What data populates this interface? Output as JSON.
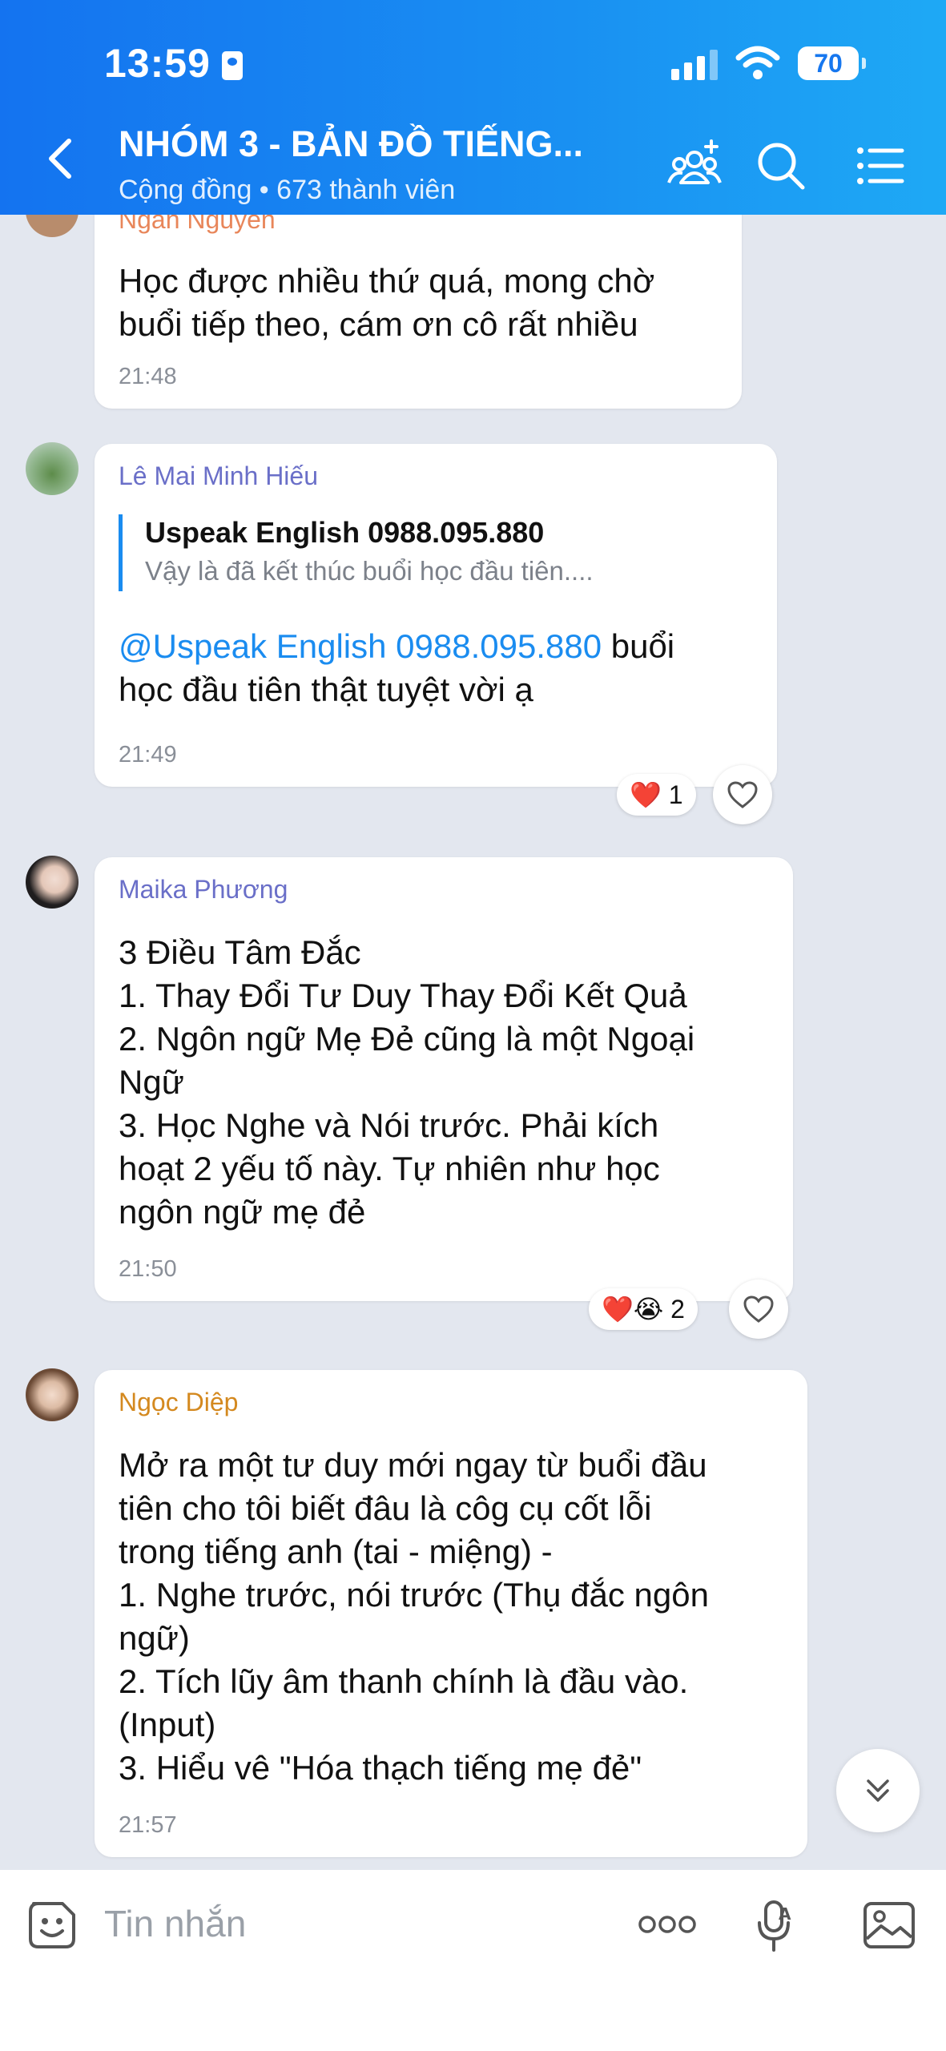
{
  "status_bar": {
    "time": "13:59",
    "battery": "70"
  },
  "header": {
    "title": "NHÓM 3 - BẢN ĐỒ TIẾNG...",
    "subtitle": "Cộng đồng • 673 thành viên"
  },
  "messages": [
    {
      "sender": "Ngan Nguyen",
      "text": "Học được nhiều thứ quá, mong chờ\nbuổi tiếp theo, cám ơn cô rất nhiều",
      "time": "21:48"
    },
    {
      "sender": "Lê Mai Minh Hiếu",
      "quote_author": "Uspeak English 0988.095.880",
      "quote_text": "Vậy là đã kết thúc buổi học đầu tiên....",
      "mention": "@Uspeak English 0988.095.880",
      "text_after_mention": " buổi\nhọc đầu tiên thật tuyệt vời ạ",
      "time": "21:49",
      "reaction_emojis": "❤️",
      "reaction_count": "1"
    },
    {
      "sender": "Maika Phương",
      "text": "3 Điều Tâm Đắc\n1. Thay Đổi Tư Duy Thay Đổi Kết Quả\n2. Ngôn ngữ Mẹ Đẻ cũng là một Ngoại\nNgữ\n3. Học Nghe và Nói trước. Phải kích\nhoạt 2 yếu tố này. Tự nhiên như học\nngôn ngữ mẹ đẻ",
      "time": "21:50",
      "reaction_emojis": "❤️😭",
      "reaction_count": "2"
    },
    {
      "sender": "Ngọc Diệp",
      "text": "Mở ra một tư duy mới ngay từ buổi đầu\ntiên cho tôi biết đâu là côg cụ cốt lỗi\ntrong tiếng anh (tai - miệng) -\n 1. Nghe trước, nói trước (Thụ đắc ngôn\nngữ)\n2. Tích lũy âm thanh chính là đầu vào.\n(Input)\n3. Hiểu vê \"Hóa thạch tiếng mẹ đẻ\"",
      "time": "21:57"
    }
  ],
  "composer": {
    "placeholder": "Tin nhắn"
  },
  "colors": {
    "header_start": "#1473f0",
    "header_end": "#1ea9f5",
    "chat_background": "#e3e7ef",
    "sender_ngan": "#e8865a",
    "sender_hieu": "#6a6fc8",
    "sender_maika": "#6a6fc8",
    "sender_diep": "#d4891f",
    "mention": "#1a8cf0"
  },
  "icons": {
    "back": "chevron-left-icon",
    "add_member": "add-group-member-icon",
    "search": "search-icon",
    "menu": "list-menu-icon",
    "sticker": "smiley-sticker-icon",
    "more": "more-dots-icon",
    "voice": "microphone-icon",
    "image": "image-gallery-icon",
    "scroll_down": "double-chevron-down-icon"
  }
}
